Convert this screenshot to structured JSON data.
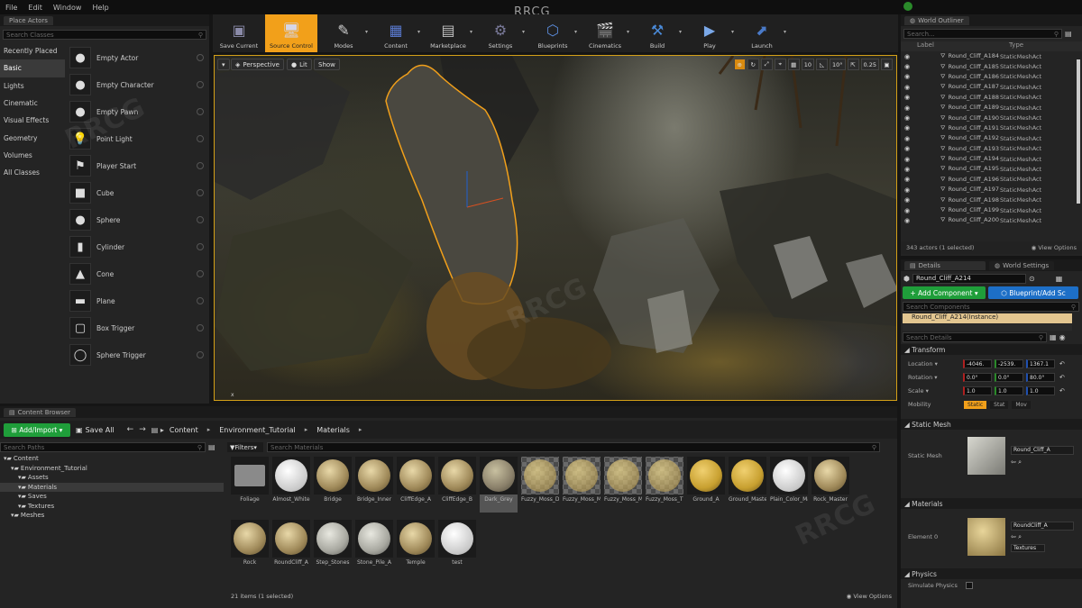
{
  "menu": [
    "File",
    "Edit",
    "Window",
    "Help"
  ],
  "window_title": "RRCG",
  "place_actors": {
    "tab": "Place Actors",
    "search_placeholder": "Search Classes",
    "categories": [
      "Recently Placed",
      "Basic",
      "Lights",
      "Cinematic",
      "Visual Effects",
      "Geometry",
      "Volumes",
      "All Classes"
    ],
    "selected_category": "Basic",
    "actors": [
      "Empty Actor",
      "Empty Character",
      "Empty Pawn",
      "Point Light",
      "Player Start",
      "Cube",
      "Sphere",
      "Cylinder",
      "Cone",
      "Plane",
      "Box Trigger",
      "Sphere Trigger"
    ]
  },
  "toolbar": {
    "buttons": [
      "Save Current",
      "Source Control",
      "Modes",
      "Content",
      "Marketplace",
      "Settings",
      "Blueprints",
      "Cinematics",
      "Build",
      "Play",
      "Launch"
    ],
    "active": "Source Control"
  },
  "viewport": {
    "perspective": "Perspective",
    "lit": "Lit",
    "show": "Show",
    "icons": [
      "⊕",
      "↻",
      "⤢",
      "⌖",
      "▦",
      "10",
      "◺",
      "10°",
      "⇱",
      "0.25",
      "▣"
    ]
  },
  "world_outliner": {
    "tab": "World Outliner",
    "search_placeholder": "Search...",
    "col_label": "Label",
    "col_type": "Type",
    "rows": [
      {
        "label": "Round_Cliff_A184",
        "type": "StaticMeshAct"
      },
      {
        "label": "Round_Cliff_A185",
        "type": "StaticMeshAct"
      },
      {
        "label": "Round_Cliff_A186",
        "type": "StaticMeshAct"
      },
      {
        "label": "Round_Cliff_A187",
        "type": "StaticMeshAct"
      },
      {
        "label": "Round_Cliff_A188",
        "type": "StaticMeshAct"
      },
      {
        "label": "Round_Cliff_A189",
        "type": "StaticMeshAct"
      },
      {
        "label": "Round_Cliff_A190",
        "type": "StaticMeshAct"
      },
      {
        "label": "Round_Cliff_A191",
        "type": "StaticMeshAct"
      },
      {
        "label": "Round_Cliff_A192",
        "type": "StaticMeshAct"
      },
      {
        "label": "Round_Cliff_A193",
        "type": "StaticMeshAct"
      },
      {
        "label": "Round_Cliff_A194",
        "type": "StaticMeshAct"
      },
      {
        "label": "Round_Cliff_A195",
        "type": "StaticMeshAct"
      },
      {
        "label": "Round_Cliff_A196",
        "type": "StaticMeshAct"
      },
      {
        "label": "Round_Cliff_A197",
        "type": "StaticMeshAct"
      },
      {
        "label": "Round_Cliff_A198",
        "type": "StaticMeshAct"
      },
      {
        "label": "Round_Cliff_A199",
        "type": "StaticMeshAct"
      },
      {
        "label": "Round_Cliff_A200",
        "type": "StaticMeshAct"
      }
    ],
    "status": "343 actors (1 selected)",
    "view_options": "View Options"
  },
  "details": {
    "tab": "Details",
    "tab2": "World Settings",
    "actor_name": "Round_Cliff_A214",
    "add_component": "+ Add Component",
    "blueprint": "Blueprint/Add Sc",
    "search_components": "Search Components",
    "instance": "Round_Cliff_A214(Instance)",
    "search_details": "Search Details",
    "transform": "Transform",
    "location_label": "Location",
    "location": [
      "-4046.",
      "-2539.",
      "1367.1"
    ],
    "rotation_label": "Rotation",
    "rotation": [
      "0.0°",
      "0.0°",
      "80.0°"
    ],
    "scale_label": "Scale",
    "scale": [
      "1.0",
      "1.0",
      "1.0"
    ],
    "mobility_label": "Mobility",
    "mobility": [
      "Static",
      "Stat",
      "Mov"
    ],
    "static_mesh_section": "Static Mesh",
    "static_mesh_label": "Static Mesh",
    "static_mesh_value": "Round_Cliff_A",
    "materials_section": "Materials",
    "element_label": "Element 0",
    "material_value": "RoundCliff_A",
    "textures": "Textures",
    "physics_section": "Physics",
    "simulate_physics": "Simulate Physics"
  },
  "content_browser": {
    "tab": "Content Browser",
    "add_import": "Add/Import",
    "save_all": "Save All",
    "path": [
      "Content",
      "Environment_Tutorial",
      "Materials"
    ],
    "search_paths": "Search Paths",
    "tree": [
      {
        "name": "Content",
        "indent": 0
      },
      {
        "name": "Environment_Tutorial",
        "indent": 1
      },
      {
        "name": "Assets",
        "indent": 2
      },
      {
        "name": "Materials",
        "indent": 2
      },
      {
        "name": "Saves",
        "indent": 2
      },
      {
        "name": "Textures",
        "indent": 2
      },
      {
        "name": "Meshes",
        "indent": 1
      }
    ],
    "selected_folder": "Materials",
    "filters": "Filters",
    "search_materials": "Search Materials",
    "assets": [
      {
        "name": "Foliage",
        "kind": "folder"
      },
      {
        "name": "Almost_White",
        "kind": "white"
      },
      {
        "name": "Bridge",
        "kind": "stone"
      },
      {
        "name": "Bridge_Inner",
        "kind": "stone"
      },
      {
        "name": "CliffEdge_A",
        "kind": "stone"
      },
      {
        "name": "CliffEdge_B",
        "kind": "stone"
      },
      {
        "name": "Dark_Grey",
        "kind": "grey"
      },
      {
        "name": "Fuzzy_Moss_Dense",
        "kind": "moss"
      },
      {
        "name": "Fuzzy_Moss_Master",
        "kind": "moss"
      },
      {
        "name": "Fuzzy_Moss_Medium",
        "kind": "moss"
      },
      {
        "name": "Fuzzy_Moss_Thin",
        "kind": "moss"
      },
      {
        "name": "Ground_A",
        "kind": "yellow"
      },
      {
        "name": "Ground_Master",
        "kind": "yellow"
      },
      {
        "name": "Plain_Color_Master",
        "kind": "white"
      },
      {
        "name": "Rock_Master",
        "kind": "stone"
      },
      {
        "name": "Rock",
        "kind": "stone"
      },
      {
        "name": "RoundCliff_A",
        "kind": "stone"
      },
      {
        "name": "Step_Stones",
        "kind": "cobble"
      },
      {
        "name": "Stone_Pile_A",
        "kind": "cobble"
      },
      {
        "name": "Temple",
        "kind": "stone"
      },
      {
        "name": "test",
        "kind": "white"
      }
    ],
    "status": "21 items (1 selected)",
    "view_options": "View Options"
  },
  "colors": {
    "accent": "#f2a01a",
    "green": "#1f9e3a",
    "blue": "#1d6fc7",
    "selection_outline": "#d4a017"
  }
}
